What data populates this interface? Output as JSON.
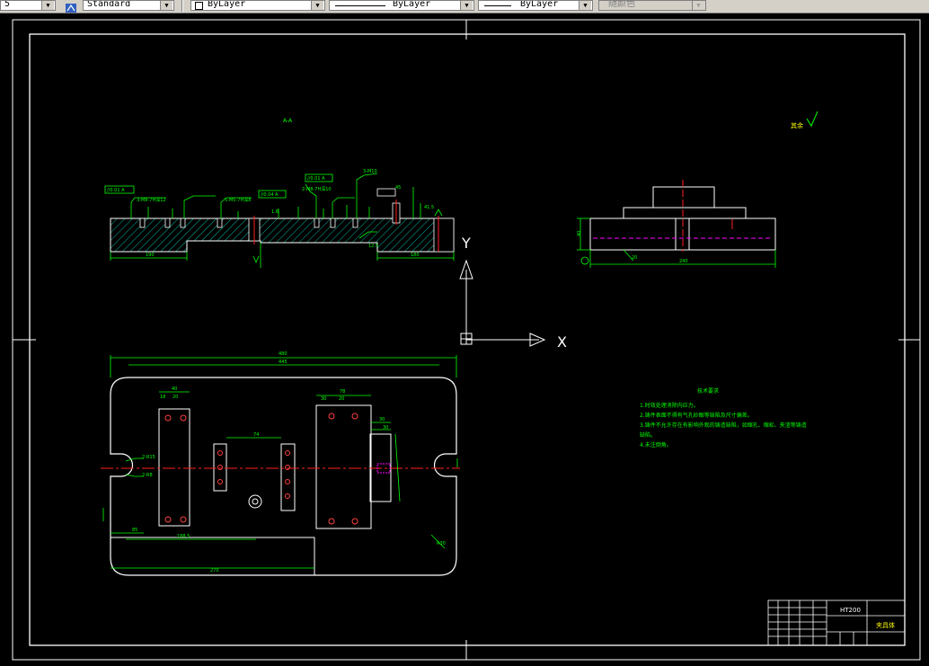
{
  "toolbar": {
    "scale_value": "5",
    "text_style": "Standard",
    "layer": "ByLayer",
    "linetype": "ByLayer",
    "lineweight": "ByLayer",
    "plot_color": "随颜色"
  },
  "drawing": {
    "section_label": "A-A",
    "roughness_note": "其余",
    "section_dims": {
      "left_len": "190",
      "right_len": "180",
      "callouts": [
        "//0.01 A",
        "//0.04 A",
        "//0.01 A",
        "3-M8-7H深12",
        "5-M5-7H深8",
        "2-M8-7H深10",
        "3-M10",
        "45",
        "1.6",
        "12.5",
        "41.5"
      ]
    },
    "side_dims": {
      "width": "240",
      "height": "40",
      "small": "20"
    },
    "plan_dims": {
      "overall": "480",
      "inner": "445",
      "bottom": "270",
      "left_x": "85",
      "mid_x": "188.5",
      "radius": "R30",
      "block_w": "40",
      "block_offsets": [
        "18",
        "20"
      ],
      "center_w": "78",
      "center_offsets": [
        "30",
        "20"
      ],
      "pocket": "74",
      "right_small": [
        "30",
        "30"
      ],
      "slot_labels": [
        "2-R15",
        "2-R8"
      ]
    },
    "axis_labels": {
      "y": "Y",
      "x": "X"
    },
    "notes": {
      "title": "技术要求",
      "lines": [
        "1.时效处理消除内应力。",
        "2.铸件表面不得有气孔砂眼等缺陷及尺寸偏差。",
        "3.铸件不允许存在有影响外观的铸造缺陷，如缩孔、缩松、夹渣等铸造",
        "缺陷。",
        "4.未注倒角。"
      ]
    },
    "title_block": {
      "material": "HT200",
      "name": "夹具体"
    }
  },
  "colors": {
    "background": "#000000",
    "outline": "#ffffff",
    "dimension": "#00ff00",
    "center": "#ff2020",
    "hatch": "#00c8a0",
    "accent": "#ff00ff"
  }
}
